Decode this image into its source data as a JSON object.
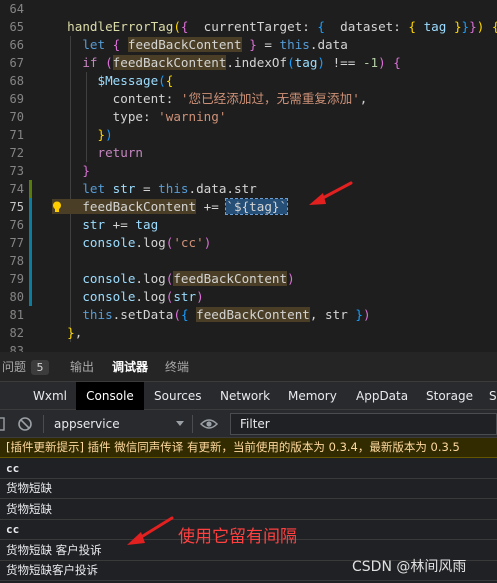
{
  "editor": {
    "current_line": 75,
    "lines": [
      {
        "n": "64",
        "segs": []
      },
      {
        "n": "65",
        "segs": [
          [
            "fn",
            "  handleErrorTag"
          ],
          [
            "br1",
            "("
          ],
          [
            "br2",
            "{"
          ],
          [
            "",
            "  currentTarget: "
          ],
          [
            "br3",
            "{"
          ],
          [
            "",
            "  dataset: "
          ],
          [
            "br1",
            "{"
          ],
          [
            "var",
            " tag "
          ],
          [
            "br1",
            "}"
          ],
          [
            "br3",
            "}"
          ],
          [
            "br2",
            "}"
          ],
          [
            "br1",
            ")"
          ],
          [
            "",
            " "
          ],
          [
            "br1",
            "{"
          ]
        ]
      },
      {
        "n": "66",
        "segs": [
          [
            "kw",
            "    let "
          ],
          [
            "br2",
            "{"
          ],
          [
            "var",
            " "
          ],
          [
            "hl",
            "feedBackContent"
          ],
          [
            "",
            " "
          ],
          [
            "br2",
            "}"
          ],
          [
            "",
            " = "
          ],
          [
            "kw",
            "this"
          ],
          [
            "",
            ".data"
          ]
        ]
      },
      {
        "n": "67",
        "segs": [
          [
            "ctl",
            "    if "
          ],
          [
            "br2",
            "("
          ],
          [
            "hl",
            "feedBackContent"
          ],
          [
            "",
            ".indexOf"
          ],
          [
            "br3",
            "("
          ],
          [
            "var",
            "tag"
          ],
          [
            "br3",
            ")"
          ],
          [
            "",
            " !== "
          ],
          [
            "num",
            "-1"
          ],
          [
            "br2",
            ")"
          ],
          [
            "",
            " "
          ],
          [
            "br2",
            "{"
          ]
        ]
      },
      {
        "n": "68",
        "segs": [
          [
            "var",
            "      $Message"
          ],
          [
            "br3",
            "("
          ],
          [
            "br1",
            "{"
          ]
        ]
      },
      {
        "n": "69",
        "segs": [
          [
            "",
            "        content: "
          ],
          [
            "str",
            "'您已经添加过，无需重复添加'"
          ],
          [
            "",
            ","
          ]
        ]
      },
      {
        "n": "70",
        "segs": [
          [
            "",
            "        type: "
          ],
          [
            "str",
            "'warning'"
          ]
        ]
      },
      {
        "n": "71",
        "segs": [
          [
            "br1",
            "      }"
          ],
          [
            "br3",
            ")"
          ]
        ]
      },
      {
        "n": "72",
        "segs": [
          [
            "ctl",
            "      return"
          ]
        ]
      },
      {
        "n": "73",
        "segs": [
          [
            "br2",
            "    }"
          ]
        ]
      },
      {
        "n": "74",
        "segs": [
          [
            "kw",
            "    let "
          ],
          [
            "var",
            "str"
          ],
          [
            "",
            " = "
          ],
          [
            "kw",
            "this"
          ],
          [
            "",
            ".data.str"
          ]
        ]
      },
      {
        "n": "75",
        "segs": [
          [
            "hl",
            "    feedBackContent"
          ],
          [
            "",
            " += "
          ],
          [
            "sel",
            "`${tag}`"
          ]
        ]
      },
      {
        "n": "76",
        "segs": [
          [
            "var",
            "    str"
          ],
          [
            "",
            " += "
          ],
          [
            "var",
            "tag"
          ]
        ]
      },
      {
        "n": "77",
        "segs": [
          [
            "var",
            "    console"
          ],
          [
            "",
            ".log"
          ],
          [
            "br2",
            "("
          ],
          [
            "str",
            "'cc'"
          ],
          [
            "br2",
            ")"
          ]
        ]
      },
      {
        "n": "78",
        "segs": []
      },
      {
        "n": "79",
        "segs": [
          [
            "var",
            "    console"
          ],
          [
            "",
            ".log"
          ],
          [
            "br2",
            "("
          ],
          [
            "hl",
            "feedBackContent"
          ],
          [
            "br2",
            ")"
          ]
        ]
      },
      {
        "n": "80",
        "segs": [
          [
            "var",
            "    console"
          ],
          [
            "",
            ".log"
          ],
          [
            "br2",
            "("
          ],
          [
            "var",
            "str"
          ],
          [
            "br2",
            ")"
          ]
        ]
      },
      {
        "n": "81",
        "segs": [
          [
            "kw",
            "    this"
          ],
          [
            "",
            ".setData"
          ],
          [
            "br2",
            "("
          ],
          [
            "br3",
            "{"
          ],
          [
            "",
            " "
          ],
          [
            "hl",
            "feedBackContent"
          ],
          [
            "",
            ", str "
          ],
          [
            "br3",
            "}"
          ],
          [
            "br2",
            ")"
          ]
        ]
      },
      {
        "n": "82",
        "segs": [
          [
            "br1",
            "  }"
          ],
          [
            "",
            ","
          ]
        ]
      },
      {
        "n": "83",
        "segs": []
      }
    ]
  },
  "panel": {
    "tabs": [
      {
        "label": "问题",
        "active": false
      },
      {
        "label": "输出",
        "active": false
      },
      {
        "label": "调试器",
        "active": true
      },
      {
        "label": "终端",
        "active": false
      }
    ],
    "problems_count": "5"
  },
  "devtools": {
    "tabs": [
      "Wxml",
      "Console",
      "Sources",
      "Network",
      "Memory",
      "AppData",
      "Storage",
      "S"
    ],
    "active_tab": "Console",
    "context": "appservice",
    "filter_placeholder": "Filter"
  },
  "console": {
    "messages": [
      {
        "text": "[插件更新提示] 插件 微信同声传译 有更新，当前使用的版本为 0.3.4，最新版本为 0.3.5",
        "type": "warn"
      },
      {
        "text": "cc",
        "type": "mono"
      },
      {
        "text": "货物短缺",
        "type": "log"
      },
      {
        "text": "货物短缺",
        "type": "log"
      },
      {
        "text": "cc",
        "type": "mono"
      },
      {
        "text": "货物短缺 客户投诉",
        "type": "log"
      },
      {
        "text": "货物短缺客户投诉",
        "type": "log"
      }
    ]
  },
  "annotation": "使用它留有间隔",
  "watermark": "CSDN @林间风雨"
}
